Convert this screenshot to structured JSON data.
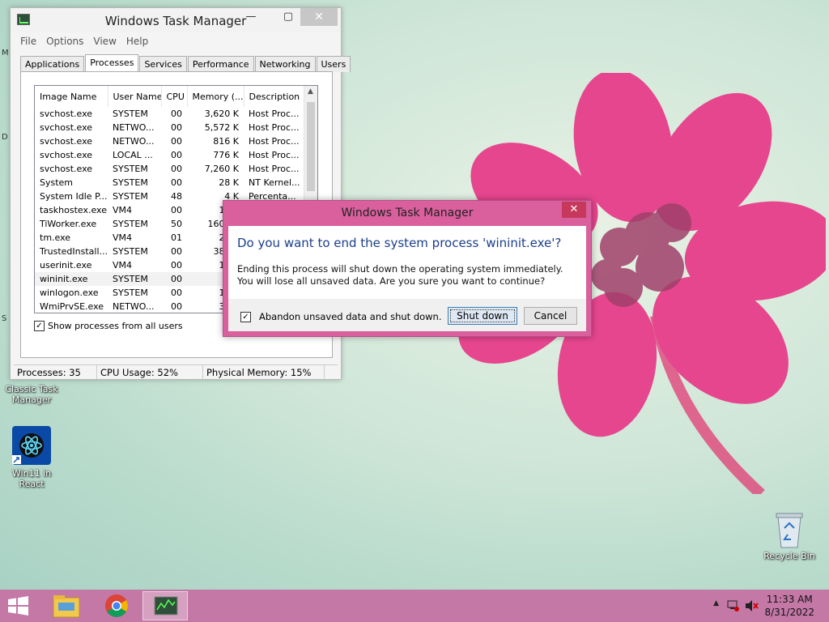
{
  "desktop": {
    "icons": [
      {
        "label": "Classic Task Manager"
      },
      {
        "label": "Win11 in React"
      },
      {
        "label": "Recycle Bin"
      }
    ],
    "edge_chars": [
      "M",
      "D",
      "S"
    ]
  },
  "task_manager": {
    "title": "Windows Task Manager",
    "window_controls": {
      "minimize": "—",
      "maximize": "▢",
      "close": "✕"
    },
    "menu": [
      "File",
      "Options",
      "View",
      "Help"
    ],
    "tabs": [
      "Applications",
      "Processes",
      "Services",
      "Performance",
      "Networking",
      "Users"
    ],
    "active_tab": "Processes",
    "columns": [
      "Image Name",
      "User Name",
      "CPU",
      "Memory (...",
      "Description"
    ],
    "rows": [
      {
        "name": "svchost.exe",
        "user": "SYSTEM",
        "cpu": "00",
        "mem": "3,620 K",
        "desc": "Host Proc..."
      },
      {
        "name": "svchost.exe",
        "user": "NETWO...",
        "cpu": "00",
        "mem": "5,572 K",
        "desc": "Host Proc..."
      },
      {
        "name": "svchost.exe",
        "user": "NETWO...",
        "cpu": "00",
        "mem": "816 K",
        "desc": "Host Proc..."
      },
      {
        "name": "svchost.exe",
        "user": "LOCAL ...",
        "cpu": "00",
        "mem": "776 K",
        "desc": "Host Proc..."
      },
      {
        "name": "svchost.exe",
        "user": "SYSTEM",
        "cpu": "00",
        "mem": "7,260 K",
        "desc": "Host Proc..."
      },
      {
        "name": "System",
        "user": "SYSTEM",
        "cpu": "00",
        "mem": "28 K",
        "desc": "NT Kernel..."
      },
      {
        "name": "System Idle P...",
        "user": "SYSTEM",
        "cpu": "48",
        "mem": "4 K",
        "desc": "Percenta..."
      },
      {
        "name": "taskhostex.exe",
        "user": "VM4",
        "cpu": "00",
        "mem": "1,31",
        "desc": ""
      },
      {
        "name": "TiWorker.exe",
        "user": "SYSTEM",
        "cpu": "50",
        "mem": "160,95",
        "desc": ""
      },
      {
        "name": "tm.exe",
        "user": "VM4",
        "cpu": "01",
        "mem": "2,44",
        "desc": ""
      },
      {
        "name": "TrustedInstall...",
        "user": "SYSTEM",
        "cpu": "00",
        "mem": "38,95",
        "desc": ""
      },
      {
        "name": "userinit.exe",
        "user": "VM4",
        "cpu": "00",
        "mem": "1,31",
        "desc": ""
      },
      {
        "name": "wininit.exe",
        "user": "SYSTEM",
        "cpu": "00",
        "mem": "63",
        "desc": "",
        "selected": true
      },
      {
        "name": "winlogon.exe",
        "user": "SYSTEM",
        "cpu": "00",
        "mem": "1,01",
        "desc": ""
      },
      {
        "name": "WmiPrvSE.exe",
        "user": "NETWO...",
        "cpu": "00",
        "mem": "3,56",
        "desc": ""
      }
    ],
    "show_all_label": "Show processes from all users",
    "show_all_checked": true,
    "status": {
      "processes": "Processes: 35",
      "cpu": "CPU Usage: 52%",
      "memory": "Physical Memory: 15%"
    }
  },
  "dialog": {
    "title": "Windows Task Manager",
    "close": "✕",
    "heading": "Do you want to end the system process 'wininit.exe'?",
    "body": "Ending this process will shut down the operating system immediately.  You will lose all unsaved data.  Are you sure you want to continue?",
    "checkbox_label": "Abandon unsaved data and shut down.",
    "checkbox_checked": true,
    "shutdown_label": "Shut down",
    "cancel_label": "Cancel"
  },
  "taskbar": {
    "items": [
      "start",
      "file-explorer",
      "chrome",
      "task-manager"
    ],
    "clock_time": "11:33 AM",
    "clock_date": "8/31/2022",
    "colors": {
      "taskbar": "#c478a6",
      "dialog_frame": "#d9609d"
    }
  }
}
